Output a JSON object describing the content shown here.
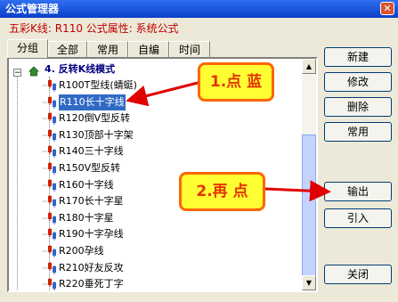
{
  "window": {
    "title": "公式管理器",
    "close_glyph": "✕"
  },
  "info": {
    "text": "五彩K线: R110 公式属性: 系统公式"
  },
  "tabs": [
    {
      "label": "分组"
    },
    {
      "label": "全部"
    },
    {
      "label": "常用"
    },
    {
      "label": "自编"
    },
    {
      "label": "时间"
    }
  ],
  "tree": {
    "root_label": "4. 反转K线模式",
    "items": [
      {
        "label": "R100T型线(蜻蜓)"
      },
      {
        "label": "R110长十字线"
      },
      {
        "label": "R120倒V型反转"
      },
      {
        "label": "R130顶部十字架"
      },
      {
        "label": "R140三十字线"
      },
      {
        "label": "R150V型反转"
      },
      {
        "label": "R160十字线"
      },
      {
        "label": "R170长十字星"
      },
      {
        "label": "R180十字星"
      },
      {
        "label": "R190十字孕线"
      },
      {
        "label": "R200孕线"
      },
      {
        "label": "R210好友反攻"
      },
      {
        "label": "R220垂死丁字"
      }
    ],
    "selected_index": 1
  },
  "buttons": {
    "new": "新建",
    "edit": "修改",
    "delete": "删除",
    "common": "常用",
    "export": "输出",
    "import": "引入",
    "close": "关闭"
  },
  "annotations": {
    "step1": "1.点 蓝",
    "step2": "2.再 点"
  },
  "colors": {
    "title_bar": "#0a3fc9",
    "selection": "#316ac5",
    "info_text": "#c00000",
    "callout_fill": "#ffff33",
    "callout_border": "#ff6600",
    "arrow": "#e00000"
  }
}
